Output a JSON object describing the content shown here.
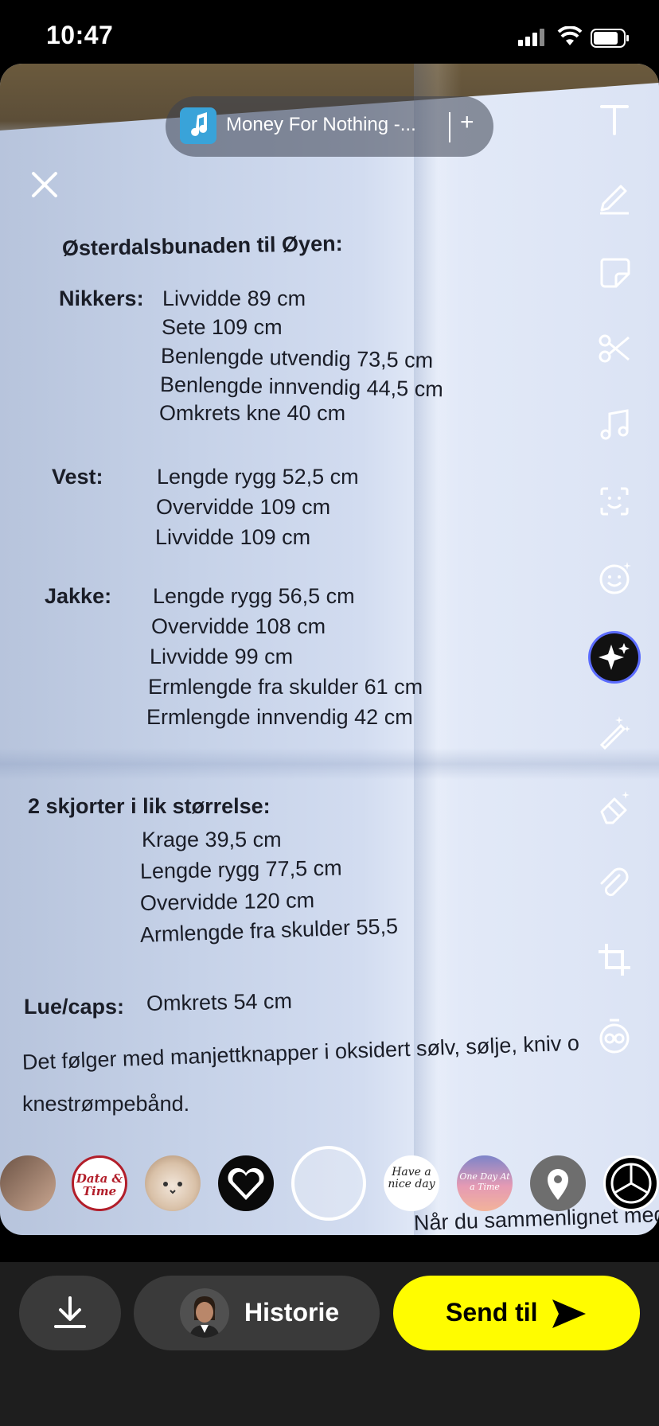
{
  "status_bar": {
    "time": "10:47"
  },
  "music": {
    "title": "Money For Nothing -...",
    "add_symbol": "+"
  },
  "document": {
    "heading": "Østerdalsbunaden til Øyen:",
    "nikkers": {
      "label": "Nikkers:",
      "lines": [
        "Livvidde 89 cm",
        "Sete 109 cm",
        "Benlengde utvendig 73,5 cm",
        "Benlengde innvendig 44,5 cm",
        "Omkrets kne 40 cm"
      ]
    },
    "vest": {
      "label": "Vest:",
      "lines": [
        "Lengde rygg 52,5 cm",
        "Overvidde 109 cm",
        "Livvidde 109 cm"
      ]
    },
    "jakke": {
      "label": "Jakke:",
      "lines": [
        "Lengde rygg 56,5 cm",
        "Overvidde 108 cm",
        "Livvidde 99 cm",
        "Ermlengde fra skulder 61 cm",
        "Ermlengde innvendig 42 cm"
      ]
    },
    "skjorter": {
      "label": "2 skjorter i lik størrelse:",
      "lines": [
        "Krage 39,5 cm",
        "Lengde rygg 77,5 cm",
        "Overvidde 120 cm",
        "Armlengde fra skulder 55,5"
      ]
    },
    "lue": {
      "label": "Lue/caps:",
      "value": "Omkrets 54 cm"
    },
    "paragraph": [
      "Det følger med manjettknapper i oksidert sølv, sølje, kniv o",
      "knestrømpebånd."
    ],
    "cut_line": "Når du sammenlignet med"
  },
  "tools": [
    "text-icon",
    "pencil-icon",
    "sticker-icon",
    "scissors-icon",
    "music-icon",
    "scan-icon",
    "emoji-icon",
    "ai-sparkle-icon",
    "magic-wand-icon",
    "eraser-icon",
    "paperclip-icon",
    "crop-icon",
    "timer-icon"
  ],
  "lenses": {
    "lens_2_text": "Data & Time",
    "lens_6_text": "Have a nice day",
    "lens_7_text": "One Day At a Time"
  },
  "bottom": {
    "story_label": "Historie",
    "send_label": "Send til"
  },
  "colors": {
    "send_button": "#fffc00",
    "bottom_bar": "#1e1e1e",
    "pill": "#3a3a3a"
  }
}
